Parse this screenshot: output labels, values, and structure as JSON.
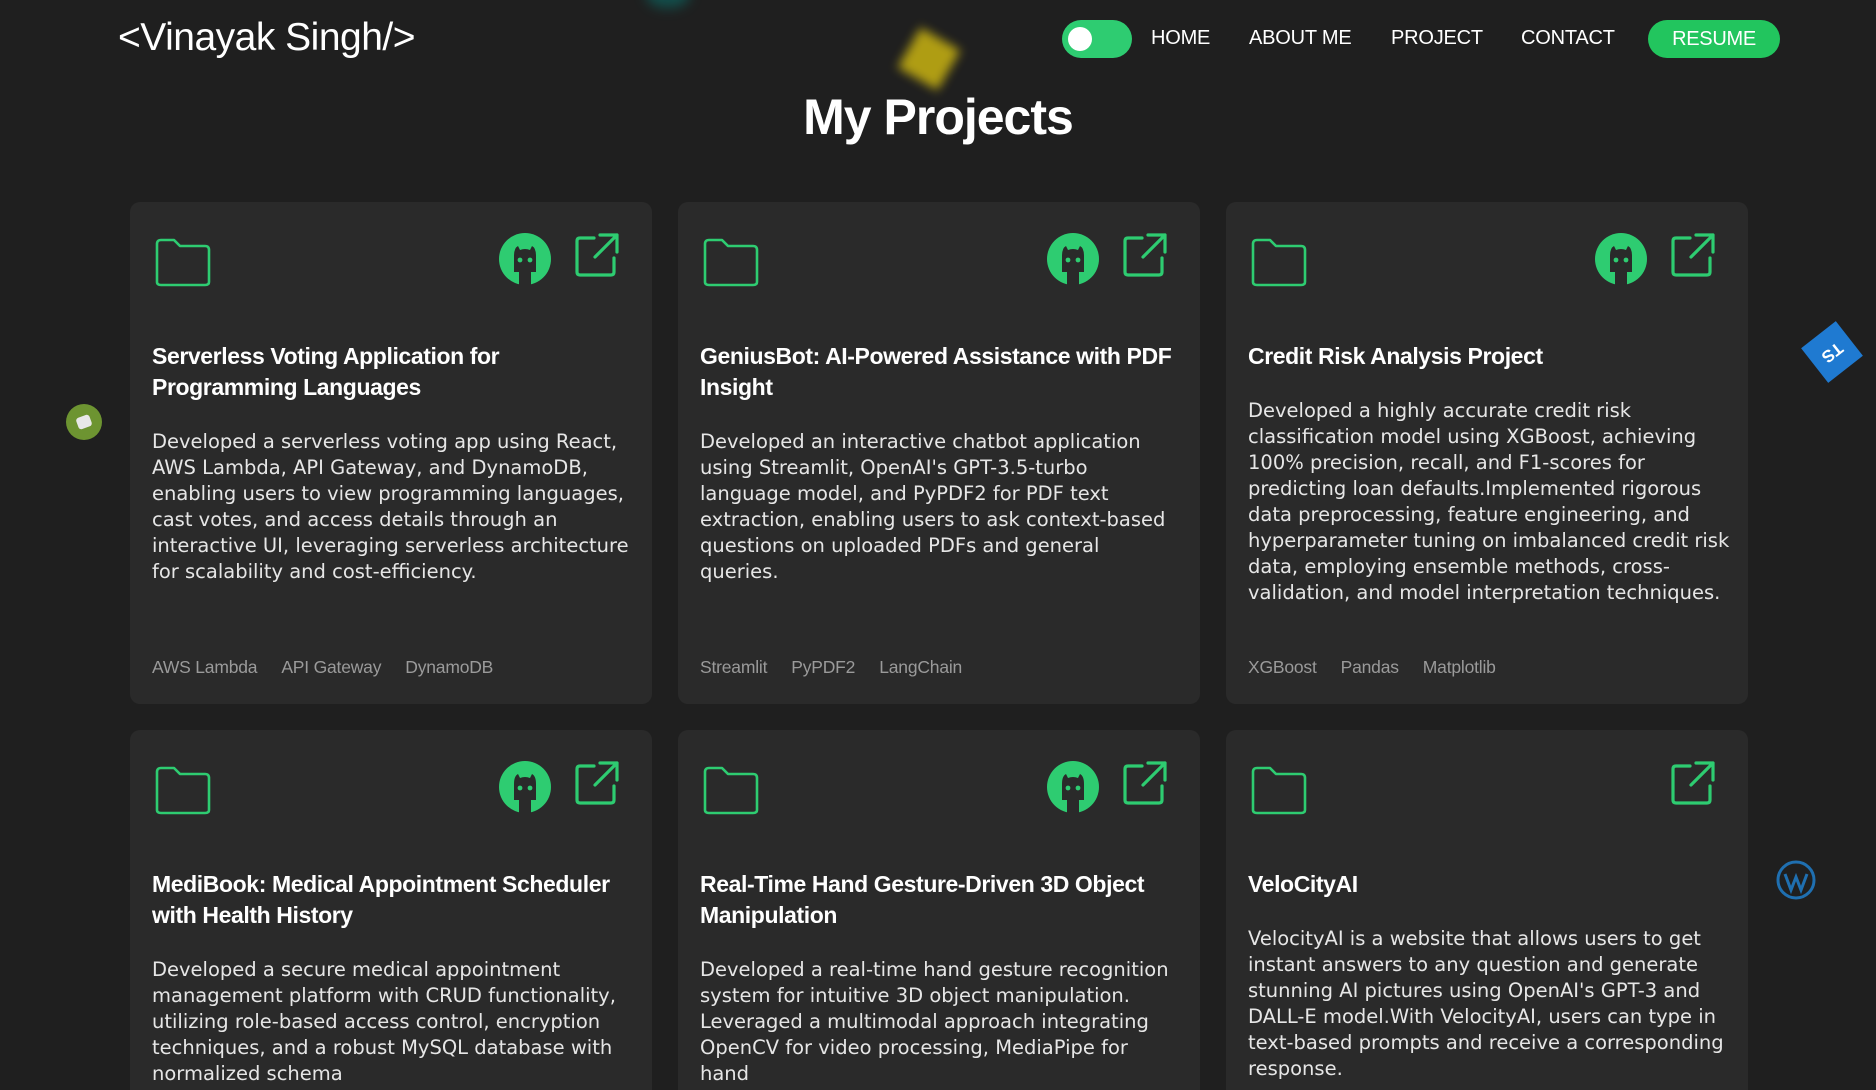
{
  "nav": {
    "logo": "<Vinayak Singh/>",
    "links": [
      "HOME",
      "ABOUT ME",
      "PROJECT",
      "CONTACT"
    ],
    "resume": "RESUME",
    "theme_toggle": "on"
  },
  "page_title": "My Projects",
  "projects": [
    {
      "title": "Serverless Voting Application for Programming Languages",
      "description": "Developed a serverless voting app using React, AWS Lambda, API Gateway, and DynamoDB, enabling users to view programming languages, cast votes, and access details through an interactive UI, leveraging serverless architecture for scalability and cost-efficiency.",
      "tags": [
        "AWS Lambda",
        "API Gateway",
        "DynamoDB"
      ]
    },
    {
      "title": "GeniusBot: AI-Powered Assistance with PDF Insight",
      "description": "Developed an interactive chatbot application using Streamlit, OpenAI's GPT-3.5-turbo language model, and PyPDF2 for PDF text extraction, enabling users to ask context-based questions on uploaded PDFs and general queries.",
      "tags": [
        "Streamlit",
        "PyPDF2",
        "LangChain"
      ]
    },
    {
      "title": "Credit Risk Analysis Project",
      "description": "Developed a highly accurate credit risk classification model using XGBoost, achieving 100% precision, recall, and F1-scores for predicting loan defaults.Implemented rigorous data preprocessing, feature engineering, and hyperparameter tuning on imbalanced credit risk data, employing ensemble methods, cross-validation, and model interpretation techniques.",
      "tags": [
        "XGBoost",
        "Pandas",
        "Matplotlib"
      ]
    },
    {
      "title": "MediBook: Medical Appointment Scheduler with Health History",
      "description": "Developed a secure medical appointment management platform with CRUD functionality, utilizing role-based access control, encryption techniques, and a robust MySQL database with normalized schema",
      "tags": []
    },
    {
      "title": "Real-Time Hand Gesture-Driven 3D Object Manipulation",
      "description": "Developed a real-time hand gesture recognition system for intuitive 3D object manipulation. Leveraged a multimodal approach integrating OpenCV for video processing, MediaPipe for hand",
      "tags": []
    },
    {
      "title": "VeloCityAI",
      "description": "VelocityAI is a website that allows users to get instant answers to any question and generate stunning AI pictures using OpenAI's GPT-3 and DALL-E model.With VelocityAI, users can type in text-based prompts and receive a corresponding response.",
      "tags": []
    }
  ],
  "floating_badges": [
    "TS"
  ],
  "colors": {
    "background": "#1f1f1f",
    "card": "#2a2a2a",
    "accent": "#22c55e",
    "icon_green": "#2ecc71",
    "tag_text": "#9a9a9a"
  }
}
